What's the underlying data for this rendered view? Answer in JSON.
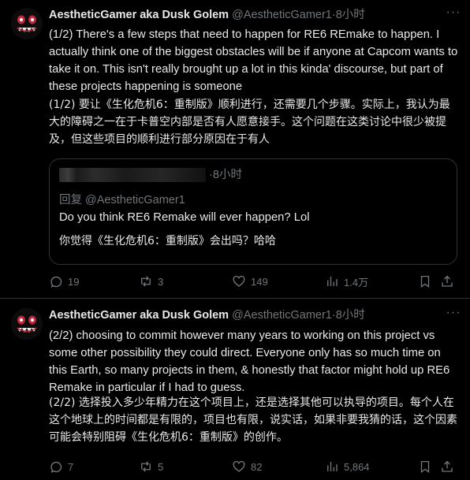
{
  "posts": [
    {
      "author": {
        "name": "AestheticGamer aka Dusk Golem",
        "handle": "@AestheticGamer1",
        "separator": "·",
        "time": "8小时"
      },
      "text_en": "(1/2) There's a few steps that need to happen for RE6 REmake to happen. I actually think one of the biggest obstacles will be if anyone at Capcom wants to take it on. This isn't really brought up a lot in this kinda' discourse, but part of these projects happening is someone",
      "text_zh": "(1/2) 要让《生化危机6：重制版》顺利进行，还需要几个步骤。实际上，我认为最大的障碍之一在于卡普空内部是否有人愿意接手。这个问题在这类讨论中很少被提及，但这些项目的顺利进行部分原因在于有人",
      "quote": {
        "separator": "·",
        "time": "8小时",
        "reply_to": "回复 @AestheticGamer1",
        "text_en": "Do you think RE6 Remake will ever happen? Lol",
        "text_zh": "你觉得《生化危机6：重制版》会出吗？哈哈"
      },
      "stats": {
        "replies": "19",
        "reposts": "3",
        "likes": "149",
        "views": "1.4万"
      }
    },
    {
      "author": {
        "name": "AestheticGamer aka Dusk Golem",
        "handle": "@AestheticGamer1",
        "separator": "·",
        "time": "8小时"
      },
      "text_en": "(2/2) choosing to commit however many years to working on this project vs some other possibility they could direct. Everyone only has so much time on this Earth, so many projects in them, & honestly that factor might hold up RE6 Remake in particular if I had to guess.",
      "text_zh": "(2/2) 选择投入多少年精力在这个项目上，还是选择其他可以执导的项目。每个人在这个地球上的时间都是有限的，项目也有限，说实话，如果非要我猜的话，这个因素可能会特别阻碍《生化危机6：重制版》的创作。",
      "stats": {
        "replies": "7",
        "reposts": "5",
        "likes": "82",
        "views": "5,864"
      }
    }
  ],
  "icons": {
    "more": "more-horizontal-icon",
    "reply": "reply-bubble-icon",
    "repost": "repost-icon",
    "like": "heart-icon",
    "views": "views-bar-chart-icon",
    "bookmark": "bookmark-icon",
    "share": "share-upload-icon"
  },
  "colors": {
    "background": "#000000",
    "text": "#e7e9ea",
    "muted": "#71767b",
    "border": "#2f3336",
    "avatar_accent": "#c0253a"
  }
}
